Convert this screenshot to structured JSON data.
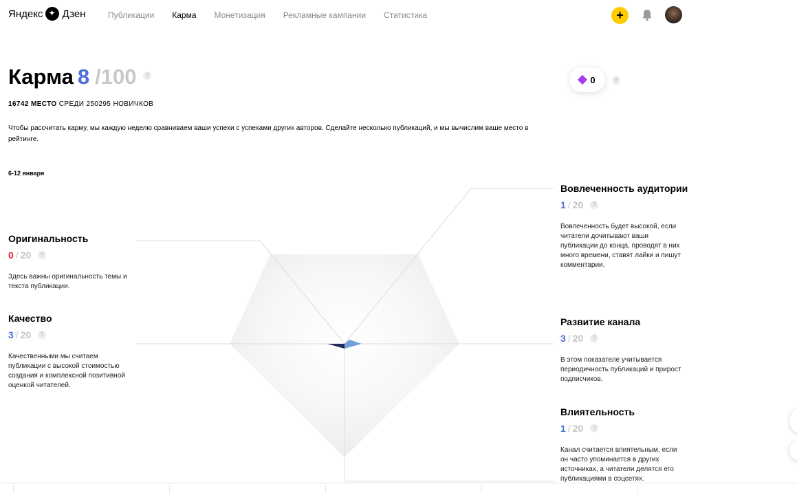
{
  "header": {
    "logo_part1": "Яндекс",
    "logo_part2": "Дзен",
    "nav": [
      {
        "label": "Публикации",
        "active": false
      },
      {
        "label": "Карма",
        "active": true
      },
      {
        "label": "Монетизация",
        "active": false
      },
      {
        "label": "Рекламные кампании",
        "active": false
      },
      {
        "label": "Статистика",
        "active": false
      }
    ],
    "plus_icon": "+",
    "accent_color": "#ffcc00"
  },
  "karma": {
    "title": "Карма",
    "score": "8",
    "max": "/100",
    "rank_place": "16742 МЕСТО",
    "rank_rest": "СРЕДИ 250295 НОВИЧКОВ",
    "description": "Чтобы рассчитать карму, мы каждую неделю сравниваем ваши успехи с успехами других авторов. Сделайте несколько публикаций, и мы вычислим ваше место в рейтинге.",
    "period": "6-12 января",
    "gems": "0"
  },
  "metrics": {
    "originality": {
      "title": "Оригинальность",
      "value": "0",
      "max": "20",
      "text": "Здесь важны оригинальность темы и текста публикации.",
      "color": "#e8223a"
    },
    "quality": {
      "title": "Качество",
      "value": "3",
      "max": "20",
      "text": "Качественными мы считаем публикации с высокой стоимостью создания и комплексной позитивной оценкой читателей.",
      "color": "#4a6fdc"
    },
    "engagement": {
      "title": "Вовлеченность аудитории",
      "value": "1",
      "max": "20",
      "text": "Вовлеченность будет высокой, если читатели дочитывают ваши публикации до конца, проводят в них много времени, ставят лайки и пишут комментарии.",
      "color": "#4a6fdc"
    },
    "growth": {
      "title": "Развитие канала",
      "value": "3",
      "max": "20",
      "text": "В этом показателе учитывается периодичность публикаций и прирост подписчиков.",
      "color": "#4a6fdc"
    },
    "influence": {
      "title": "Влиятельность",
      "value": "1",
      "max": "20",
      "text": "Канал считается влиятельным, если он часто упоминается в других источниках, а читатели делятся его публикациями в соцсетях.",
      "color": "#4a6fdc"
    }
  },
  "slash": "/",
  "help_glyph": "?"
}
